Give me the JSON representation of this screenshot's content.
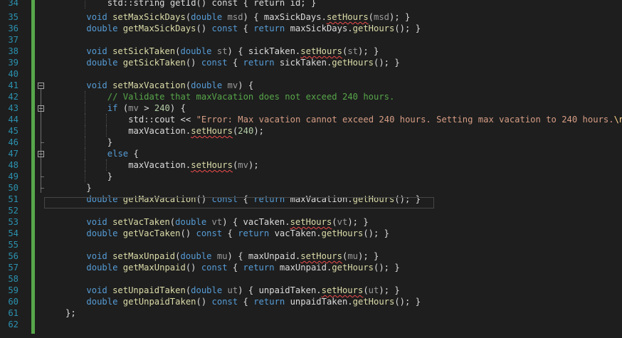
{
  "editor": {
    "colors": {
      "background": "#1e1e1e",
      "line_number": "#2b91af",
      "keyword": "#569cd6",
      "function": "#dcdcaa",
      "parameter": "#9a9a9a",
      "string": "#d69d85",
      "comment": "#57a64a",
      "change_bar": "#57a64a",
      "squiggle": "#f14c4c"
    },
    "lines": [
      {
        "num": "34",
        "indent": 2,
        "parts": [
          {
            "t": "std::string getId() const { return id; }",
            "c": "cut"
          }
        ]
      },
      {
        "num": "35",
        "indent": 1,
        "parts": [
          {
            "t": "void ",
            "c": "kw"
          },
          {
            "t": "setMaxSickDays",
            "c": "fn"
          },
          {
            "t": "(",
            "c": ""
          },
          {
            "t": "double ",
            "c": "kw"
          },
          {
            "t": "msd",
            "c": "pm"
          },
          {
            "t": ") { maxSickDays.",
            "c": ""
          },
          {
            "t": "setHours",
            "c": "fn sq"
          },
          {
            "t": "(",
            "c": ""
          },
          {
            "t": "msd",
            "c": "pm"
          },
          {
            "t": "); }",
            "c": ""
          }
        ]
      },
      {
        "num": "36",
        "indent": 1,
        "parts": [
          {
            "t": "double ",
            "c": "kw"
          },
          {
            "t": "getMaxSickDays",
            "c": "fn"
          },
          {
            "t": "() ",
            "c": ""
          },
          {
            "t": "const",
            "c": "kw"
          },
          {
            "t": " { ",
            "c": ""
          },
          {
            "t": "return",
            "c": "kw"
          },
          {
            "t": " maxSickDays.",
            "c": ""
          },
          {
            "t": "getHours",
            "c": "fn"
          },
          {
            "t": "(); }",
            "c": ""
          }
        ]
      },
      {
        "num": "37",
        "indent": 0,
        "parts": []
      },
      {
        "num": "38",
        "indent": 1,
        "parts": [
          {
            "t": "void ",
            "c": "kw"
          },
          {
            "t": "setSickTaken",
            "c": "fn"
          },
          {
            "t": "(",
            "c": ""
          },
          {
            "t": "double ",
            "c": "kw"
          },
          {
            "t": "st",
            "c": "pm"
          },
          {
            "t": ") { sickTaken.",
            "c": ""
          },
          {
            "t": "setHours",
            "c": "fn sq"
          },
          {
            "t": "(",
            "c": ""
          },
          {
            "t": "st",
            "c": "pm"
          },
          {
            "t": "); }",
            "c": ""
          }
        ]
      },
      {
        "num": "39",
        "indent": 1,
        "parts": [
          {
            "t": "double ",
            "c": "kw"
          },
          {
            "t": "getSickTaken",
            "c": "fn"
          },
          {
            "t": "() ",
            "c": ""
          },
          {
            "t": "const",
            "c": "kw"
          },
          {
            "t": " { ",
            "c": ""
          },
          {
            "t": "return",
            "c": "kw"
          },
          {
            "t": " sickTaken.",
            "c": ""
          },
          {
            "t": "getHours",
            "c": "fn"
          },
          {
            "t": "(); }",
            "c": ""
          }
        ]
      },
      {
        "num": "40",
        "indent": 0,
        "parts": []
      },
      {
        "num": "41",
        "indent": 1,
        "parts": [
          {
            "t": "void ",
            "c": "kw"
          },
          {
            "t": "setMaxVacation",
            "c": "fn"
          },
          {
            "t": "(",
            "c": ""
          },
          {
            "t": "double ",
            "c": "kw"
          },
          {
            "t": "mv",
            "c": "pm"
          },
          {
            "t": ") {",
            "c": ""
          }
        ]
      },
      {
        "num": "42",
        "indent": 2,
        "parts": [
          {
            "t": "// Validate that maxVacation does not exceed 240 hours.",
            "c": "cm"
          }
        ]
      },
      {
        "num": "43",
        "indent": 2,
        "parts": [
          {
            "t": "if",
            "c": "kw"
          },
          {
            "t": " (",
            "c": ""
          },
          {
            "t": "mv",
            "c": "pm"
          },
          {
            "t": " > ",
            "c": ""
          },
          {
            "t": "240",
            "c": "num"
          },
          {
            "t": ") {",
            "c": ""
          }
        ]
      },
      {
        "num": "44",
        "indent": 3,
        "parts": [
          {
            "t": "std::cout << ",
            "c": ""
          },
          {
            "t": "\"Error: Max vacation cannot exceed 240 hours. Setting max vacation to 240 hours.",
            "c": "str"
          },
          {
            "t": "\\n",
            "c": "esc"
          },
          {
            "t": "\"",
            "c": "str"
          },
          {
            "t": ";",
            "c": ""
          }
        ]
      },
      {
        "num": "45",
        "indent": 3,
        "parts": [
          {
            "t": "maxVacation.",
            "c": ""
          },
          {
            "t": "setHours",
            "c": "fn sq"
          },
          {
            "t": "(",
            "c": ""
          },
          {
            "t": "240",
            "c": "num"
          },
          {
            "t": ");",
            "c": ""
          }
        ]
      },
      {
        "num": "46",
        "indent": 2,
        "parts": [
          {
            "t": "}",
            "c": ""
          }
        ]
      },
      {
        "num": "47",
        "indent": 2,
        "parts": [
          {
            "t": "else",
            "c": "kw"
          },
          {
            "t": " {",
            "c": ""
          }
        ]
      },
      {
        "num": "48",
        "indent": 3,
        "parts": [
          {
            "t": "maxVacation.",
            "c": ""
          },
          {
            "t": "setHours",
            "c": "fn sq"
          },
          {
            "t": "(",
            "c": ""
          },
          {
            "t": "mv",
            "c": "pm"
          },
          {
            "t": ");",
            "c": ""
          }
        ]
      },
      {
        "num": "49",
        "indent": 2,
        "parts": [
          {
            "t": "}",
            "c": ""
          }
        ]
      },
      {
        "num": "50",
        "indent": 1,
        "parts": [
          {
            "t": "}",
            "c": ""
          }
        ]
      },
      {
        "num": "51",
        "indent": 1,
        "parts": [
          {
            "t": "double ",
            "c": "kw"
          },
          {
            "t": "getMaxVacation",
            "c": "fn"
          },
          {
            "t": "() ",
            "c": ""
          },
          {
            "t": "const",
            "c": "kw"
          },
          {
            "t": " { ",
            "c": ""
          },
          {
            "t": "return",
            "c": "kw"
          },
          {
            "t": " maxVacation.",
            "c": ""
          },
          {
            "t": "getHours",
            "c": "fn"
          },
          {
            "t": "(); }",
            "c": ""
          }
        ]
      },
      {
        "num": "52",
        "indent": 0,
        "parts": []
      },
      {
        "num": "53",
        "indent": 1,
        "parts": [
          {
            "t": "void ",
            "c": "kw"
          },
          {
            "t": "setVacTaken",
            "c": "fn"
          },
          {
            "t": "(",
            "c": ""
          },
          {
            "t": "double ",
            "c": "kw"
          },
          {
            "t": "vt",
            "c": "pm"
          },
          {
            "t": ") { vacTaken.",
            "c": ""
          },
          {
            "t": "setHours",
            "c": "fn sq"
          },
          {
            "t": "(",
            "c": ""
          },
          {
            "t": "vt",
            "c": "pm"
          },
          {
            "t": "); }",
            "c": ""
          }
        ]
      },
      {
        "num": "54",
        "indent": 1,
        "parts": [
          {
            "t": "double ",
            "c": "kw"
          },
          {
            "t": "getVacTaken",
            "c": "fn"
          },
          {
            "t": "() ",
            "c": ""
          },
          {
            "t": "const",
            "c": "kw"
          },
          {
            "t": " { ",
            "c": ""
          },
          {
            "t": "return",
            "c": "kw"
          },
          {
            "t": " vacTaken.",
            "c": ""
          },
          {
            "t": "getHours",
            "c": "fn"
          },
          {
            "t": "(); }",
            "c": ""
          }
        ]
      },
      {
        "num": "55",
        "indent": 0,
        "parts": []
      },
      {
        "num": "56",
        "indent": 1,
        "parts": [
          {
            "t": "void ",
            "c": "kw"
          },
          {
            "t": "setMaxUnpaid",
            "c": "fn"
          },
          {
            "t": "(",
            "c": ""
          },
          {
            "t": "double ",
            "c": "kw"
          },
          {
            "t": "mu",
            "c": "pm"
          },
          {
            "t": ") { maxUnpaid.",
            "c": ""
          },
          {
            "t": "setHours",
            "c": "fn sq"
          },
          {
            "t": "(",
            "c": ""
          },
          {
            "t": "mu",
            "c": "pm"
          },
          {
            "t": "); }",
            "c": ""
          }
        ]
      },
      {
        "num": "57",
        "indent": 1,
        "parts": [
          {
            "t": "double ",
            "c": "kw"
          },
          {
            "t": "getMaxUnpaid",
            "c": "fn"
          },
          {
            "t": "() ",
            "c": ""
          },
          {
            "t": "const",
            "c": "kw"
          },
          {
            "t": " { ",
            "c": ""
          },
          {
            "t": "return",
            "c": "kw"
          },
          {
            "t": " maxUnpaid.",
            "c": ""
          },
          {
            "t": "getHours",
            "c": "fn"
          },
          {
            "t": "(); }",
            "c": ""
          }
        ]
      },
      {
        "num": "58",
        "indent": 0,
        "parts": []
      },
      {
        "num": "59",
        "indent": 1,
        "parts": [
          {
            "t": "void ",
            "c": "kw"
          },
          {
            "t": "setUnpaidTaken",
            "c": "fn"
          },
          {
            "t": "(",
            "c": ""
          },
          {
            "t": "double ",
            "c": "kw"
          },
          {
            "t": "ut",
            "c": "pm"
          },
          {
            "t": ") { unpaidTaken.",
            "c": ""
          },
          {
            "t": "setHours",
            "c": "fn sq"
          },
          {
            "t": "(",
            "c": ""
          },
          {
            "t": "ut",
            "c": "pm"
          },
          {
            "t": "); }",
            "c": ""
          }
        ]
      },
      {
        "num": "60",
        "indent": 1,
        "parts": [
          {
            "t": "double ",
            "c": "kw"
          },
          {
            "t": "getUnpaidTaken",
            "c": "fn"
          },
          {
            "t": "() ",
            "c": ""
          },
          {
            "t": "const",
            "c": "kw"
          },
          {
            "t": " { ",
            "c": ""
          },
          {
            "t": "return",
            "c": "kw"
          },
          {
            "t": " unpaidTaken.",
            "c": ""
          },
          {
            "t": "getHours",
            "c": "fn"
          },
          {
            "t": "(); }",
            "c": ""
          }
        ]
      },
      {
        "num": "61",
        "indent": 0,
        "parts": [
          {
            "t": "};",
            "c": ""
          }
        ]
      },
      {
        "num": "62",
        "indent": 0,
        "parts": []
      }
    ]
  }
}
